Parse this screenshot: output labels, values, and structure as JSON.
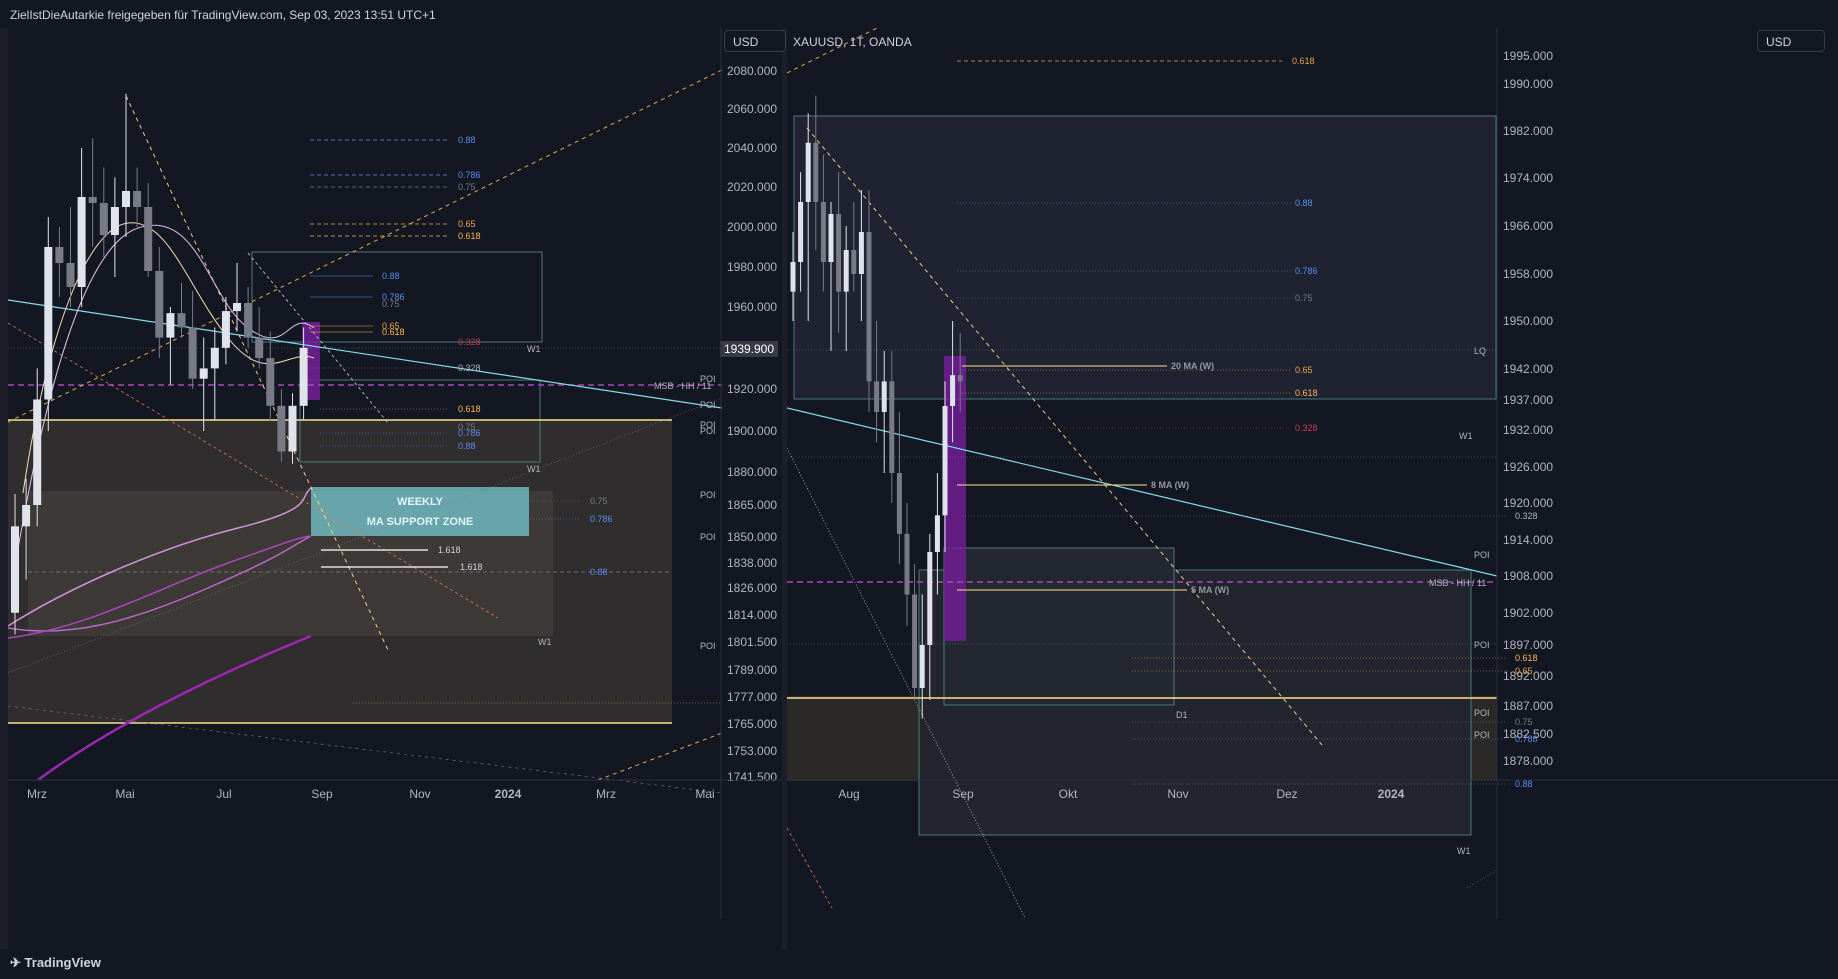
{
  "header": {
    "share_text": "ZielIstDieAutarkie freigegeben für TradingView.com, Sep 03, 2023 13:51 UTC+1"
  },
  "footer": {
    "brand": "TradingView"
  },
  "colors": {
    "background": "#131722",
    "bull": "#d1d4dc",
    "bear": "#787b86",
    "purple": "#9c27b0",
    "gold": "#ffe08a",
    "cyan": "#80deea",
    "fib_blue": "#5b8def",
    "fib_orange": "#e6a646"
  },
  "chart_data": [
    {
      "type": "candlestick",
      "panel": "left",
      "currency_button": "USD",
      "price_ticks": [
        "2080.000",
        "2060.000",
        "2040.000",
        "2020.000",
        "2000.000",
        "1980.000",
        "1960.000",
        "1920.000",
        "1900.000",
        "1880.000",
        "1865.000",
        "1850.000",
        "1838.000",
        "1826.000",
        "1814.000",
        "1801.500",
        "1789.000",
        "1777.000",
        "1765.000",
        "1753.000",
        "1741.500"
      ],
      "current_price": "1939.900",
      "time_ticks": [
        "Mrz",
        "Mai",
        "Jul",
        "Sep",
        "Nov",
        "2024",
        "Mrz",
        "Mai"
      ],
      "candles": [
        {
          "o": 1815,
          "h": 1870,
          "l": 1805,
          "c": 1855
        },
        {
          "o": 1855,
          "h": 1877,
          "l": 1830,
          "c": 1865
        },
        {
          "o": 1865,
          "h": 1930,
          "l": 1855,
          "c": 1915
        },
        {
          "o": 1915,
          "h": 2005,
          "l": 1900,
          "c": 1990
        },
        {
          "o": 1990,
          "h": 2000,
          "l": 1965,
          "c": 1982
        },
        {
          "o": 1982,
          "h": 2010,
          "l": 1960,
          "c": 1970
        },
        {
          "o": 1970,
          "h": 2040,
          "l": 1960,
          "c": 2015
        },
        {
          "o": 2015,
          "h": 2045,
          "l": 1990,
          "c": 2012
        },
        {
          "o": 2012,
          "h": 2030,
          "l": 1985,
          "c": 1996
        },
        {
          "o": 1996,
          "h": 2025,
          "l": 1975,
          "c": 2010
        },
        {
          "o": 2010,
          "h": 2068,
          "l": 1995,
          "c": 2018
        },
        {
          "o": 2018,
          "h": 2030,
          "l": 2000,
          "c": 2010
        },
        {
          "o": 2010,
          "h": 2022,
          "l": 1975,
          "c": 1978
        },
        {
          "o": 1978,
          "h": 1990,
          "l": 1935,
          "c": 1945
        },
        {
          "o": 1945,
          "h": 1960,
          "l": 1922,
          "c": 1957
        },
        {
          "o": 1957,
          "h": 1972,
          "l": 1945,
          "c": 1950
        },
        {
          "o": 1950,
          "h": 1968,
          "l": 1920,
          "c": 1925
        },
        {
          "o": 1925,
          "h": 1945,
          "l": 1900,
          "c": 1930
        },
        {
          "o": 1930,
          "h": 1950,
          "l": 1905,
          "c": 1940
        },
        {
          "o": 1940,
          "h": 1965,
          "l": 1932,
          "c": 1958
        },
        {
          "o": 1958,
          "h": 1982,
          "l": 1948,
          "c": 1962
        },
        {
          "o": 1962,
          "h": 1970,
          "l": 1940,
          "c": 1945
        },
        {
          "o": 1945,
          "h": 1960,
          "l": 1930,
          "c": 1935
        },
        {
          "o": 1935,
          "h": 1948,
          "l": 1905,
          "c": 1912
        },
        {
          "o": 1912,
          "h": 1920,
          "l": 1885,
          "c": 1890
        },
        {
          "o": 1890,
          "h": 1918,
          "l": 1884,
          "c": 1912
        },
        {
          "o": 1912,
          "h": 1950,
          "l": 1905,
          "c": 1940
        }
      ],
      "fib_levels": [
        "0.88",
        "0.786",
        "0.75",
        "0.65",
        "0.618",
        "0.88",
        "0.786",
        "0.75",
        "0.65",
        "0.618",
        "0.328",
        "0.328",
        "0.618",
        "0.75",
        "0.786",
        "0.88",
        "0.75",
        "0.786",
        "1.618",
        "1.618",
        "0.88"
      ],
      "labels": [
        "MSB - HH / 11",
        "POI",
        "POI",
        "POI",
        "POI",
        "POI",
        "POI",
        "POI",
        "W1",
        "W1",
        "W1"
      ],
      "annotation": {
        "line1": "WEEKLY",
        "line2": "MA SUPPORT ZONE"
      }
    },
    {
      "type": "candlestick",
      "panel": "right",
      "symbol": "XAUUSD, 1T, OANDA",
      "currency_button": "USD",
      "price_ticks": [
        "1995.000",
        "1990.000",
        "1982.000",
        "1974.000",
        "1966.000",
        "1958.000",
        "1950.000",
        "1942.000",
        "1937.000",
        "1932.000",
        "1926.000",
        "1920.000",
        "1914.000",
        "1908.000",
        "1902.000",
        "1897.000",
        "1892.000",
        "1887.000",
        "1882.500",
        "1878.000"
      ],
      "time_ticks": [
        "Aug",
        "Sep",
        "Okt",
        "Nov",
        "Dez",
        "2024"
      ],
      "candles": [
        {
          "o": 1955,
          "h": 1965,
          "l": 1950,
          "c": 1960
        },
        {
          "o": 1960,
          "h": 1975,
          "l": 1955,
          "c": 1970
        },
        {
          "o": 1970,
          "h": 1985,
          "l": 1950,
          "c": 1980
        },
        {
          "o": 1980,
          "h": 1988,
          "l": 1962,
          "c": 1970
        },
        {
          "o": 1970,
          "h": 1978,
          "l": 1955,
          "c": 1960
        },
        {
          "o": 1960,
          "h": 1970,
          "l": 1945,
          "c": 1968
        },
        {
          "o": 1968,
          "h": 1975,
          "l": 1948,
          "c": 1955
        },
        {
          "o": 1955,
          "h": 1966,
          "l": 1945,
          "c": 1962
        },
        {
          "o": 1962,
          "h": 1970,
          "l": 1955,
          "c": 1958
        },
        {
          "o": 1958,
          "h": 1972,
          "l": 1950,
          "c": 1965
        },
        {
          "o": 1965,
          "h": 1972,
          "l": 1935,
          "c": 1940
        },
        {
          "o": 1940,
          "h": 1950,
          "l": 1930,
          "c": 1935
        },
        {
          "o": 1935,
          "h": 1945,
          "l": 1925,
          "c": 1940
        },
        {
          "o": 1940,
          "h": 1945,
          "l": 1920,
          "c": 1925
        },
        {
          "o": 1925,
          "h": 1935,
          "l": 1910,
          "c": 1915
        },
        {
          "o": 1915,
          "h": 1920,
          "l": 1900,
          "c": 1905
        },
        {
          "o": 1905,
          "h": 1910,
          "l": 1888,
          "c": 1890
        },
        {
          "o": 1890,
          "h": 1905,
          "l": 1885,
          "c": 1897
        },
        {
          "o": 1897,
          "h": 1915,
          "l": 1888,
          "c": 1912
        },
        {
          "o": 1912,
          "h": 1925,
          "l": 1905,
          "c": 1918
        },
        {
          "o": 1918,
          "h": 1940,
          "l": 1912,
          "c": 1936
        },
        {
          "o": 1936,
          "h": 1950,
          "l": 1930,
          "c": 1941
        },
        {
          "o": 1941,
          "h": 1948,
          "l": 1935,
          "c": 1940
        }
      ],
      "fib_levels": [
        "0.618",
        "0.88",
        "0.786",
        "0.75",
        "0.65",
        "0.618",
        "0.328",
        "0.328",
        "0.618",
        "0.65",
        "0.75",
        "0.786",
        "0.88"
      ],
      "ma_labels": [
        "20 MA (W)",
        "8 MA (W)",
        "5 MA (W)"
      ],
      "labels": [
        "MSB - HH / 11",
        "POI",
        "POI",
        "POI",
        "POI",
        "LQ",
        "W1",
        "W1",
        "D1"
      ]
    }
  ]
}
